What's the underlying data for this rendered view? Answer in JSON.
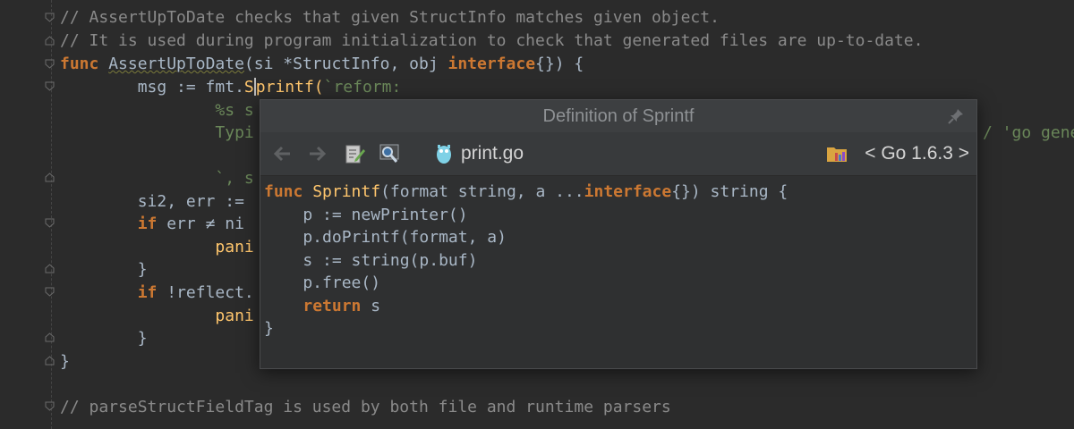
{
  "editor": {
    "lines": [
      {
        "t": "// AssertUpToDate checks that given StructInfo matches given object.",
        "c": "cmt"
      },
      {
        "t": "// It is used during program initialization to check that generated files are up-to-date.",
        "c": "cmt"
      },
      {
        "t": "func AssertUpToDate(si *StructInfo, obj interface{}) {"
      },
      {
        "t": "        msg := fmt.Sprintf(`reform:"
      },
      {
        "t": "                %s s"
      },
      {
        "t": "                Typi"
      },
      {
        "t": "                `, s"
      },
      {
        "t": "        si2, err :="
      },
      {
        "t": "        if err ≠ ni"
      },
      {
        "t": "                pani"
      },
      {
        "t": "        }"
      },
      {
        "t": "        if !reflect."
      },
      {
        "t": "                pani"
      },
      {
        "t": "        }"
      },
      {
        "t": "}"
      },
      {
        "t": "// parseStructFieldTag is used by both file and runtime parsers",
        "c": "cmt"
      }
    ],
    "right_overflow_text": "/ 'go gene",
    "func_kw": "func",
    "func_name": "AssertUpToDate",
    "params": "(si *StructInfo, obj ",
    "iface_kw": "interface",
    "params_end": "{}) {",
    "msg_prefix": "msg := fmt.",
    "sprintf_a": "S",
    "sprintf_b": "printf(",
    "msg_str": "`reform:",
    "if_kw": "if",
    "err_rest": " err ≠ ni",
    "refl_rest": " !reflect.",
    "si2": "si2, err :=",
    "pani": "pani",
    "brace_close": "}",
    "str1": "%s s",
    "str2": "Typi",
    "str3": "`, s"
  },
  "popup": {
    "title": "Definition of Sprintf",
    "file": "print.go",
    "sdk": "< Go 1.6.3 >",
    "code": {
      "l1_kw": "func",
      "l1_name": "Sprintf",
      "l1_params": "(format string, a ...",
      "l1_iface": "interface",
      "l1_end": "{}) string {",
      "l2": "    p := newPrinter()",
      "l3": "    p.doPrintf(format, a)",
      "l4": "    s := string(p.buf)",
      "l5": "    p.free()",
      "l6_kw": "return",
      "l6_rest": " s",
      "l7": "}"
    }
  },
  "colors": {
    "background": "#2b2b2b",
    "keyword": "#cc7832",
    "function": "#ffc66d",
    "string": "#6a8759",
    "comment": "#8a8a8a",
    "text": "#a9b7c6"
  }
}
